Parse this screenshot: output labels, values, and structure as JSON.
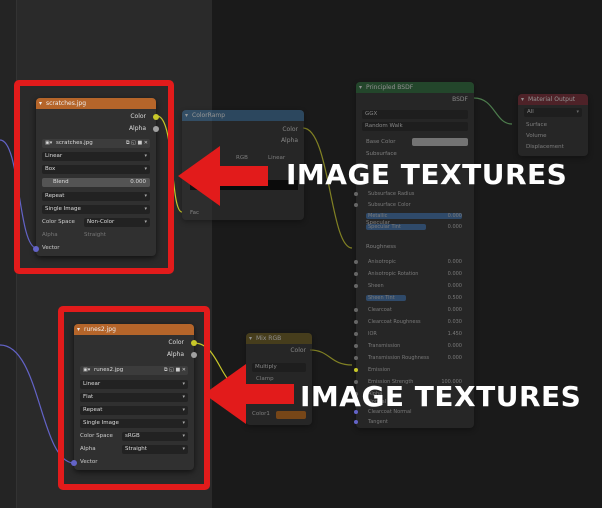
{
  "colors": {
    "accent_red": "#e21b1b",
    "image_header": "#b5652a"
  },
  "node_top": {
    "title": "scratches.jpg",
    "out_color": "Color",
    "out_alpha": "Alpha",
    "image_name": "scratches.jpg",
    "interpolation": "Linear",
    "projection": "Box",
    "blend_label": "Blend",
    "blend_value": "0.000",
    "extension": "Repeat",
    "source": "Single Image",
    "color_space_label": "Color Space",
    "color_space": "Non-Color",
    "alpha_label": "Alpha",
    "alpha_value": "Straight",
    "vector": "Vector"
  },
  "node_bottom": {
    "title": "runes2.jpg",
    "out_color": "Color",
    "out_alpha": "Alpha",
    "image_name": "runes2.jpg",
    "interpolation": "Linear",
    "projection": "Flat",
    "extension": "Repeat",
    "source": "Single Image",
    "color_space_label": "Color Space",
    "color_space": "sRGB",
    "alpha_label": "Alpha",
    "alpha_value": "Straight",
    "vector": "Vector"
  },
  "node_colorramp": {
    "title": "ColorRamp",
    "out_color": "Color",
    "out_alpha": "Alpha",
    "mode": "RGB",
    "interp": "Linear",
    "fac": "Fac"
  },
  "node_bsdf": {
    "title": "Principled BSDF",
    "bsdf_out": "BSDF",
    "distribution": "GGX",
    "subsurface_method": "Random Walk",
    "base_color": "Base Color",
    "subsurface": "Subsurface",
    "specular": "Specular",
    "roughness": "Roughness",
    "rows": [
      {
        "label": "Subsurface Radius",
        "value": ""
      },
      {
        "label": "Subsurface Color",
        "value": ""
      },
      {
        "label": "Metallic",
        "value": "0.000"
      },
      {
        "label": "Specular Tint",
        "value": "0.000"
      },
      {
        "label": "Anisotropic",
        "value": "0.000"
      },
      {
        "label": "Anisotropic Rotation",
        "value": "0.000"
      },
      {
        "label": "Sheen",
        "value": "0.000"
      },
      {
        "label": "Sheen Tint",
        "value": "0.500"
      },
      {
        "label": "Clearcoat",
        "value": "0.000"
      },
      {
        "label": "Clearcoat Roughness",
        "value": "0.030"
      },
      {
        "label": "IOR",
        "value": "1.450"
      },
      {
        "label": "Transmission",
        "value": "0.000"
      },
      {
        "label": "Transmission Roughness",
        "value": "0.000"
      }
    ],
    "emission": "Emission",
    "emission_strength": "Emission Strength",
    "emission_strength_value": "100.000",
    "alpha": "Alpha",
    "normal": "Normal",
    "clearcoat_normal": "Clearcoat Normal",
    "tangent": "Tangent"
  },
  "node_material_output": {
    "title": "Material Output",
    "target": "All",
    "surface": "Surface",
    "volume": "Volume",
    "displacement": "Displacement"
  },
  "node_mix": {
    "title": "Mix RGB",
    "out_color": "Color",
    "blend_type": "Multiply",
    "clamp": "Clamp",
    "color1": "Color1"
  },
  "captions": {
    "top": "IMAGE TEXTURES",
    "bottom": "IMAGE TEXTURES"
  }
}
